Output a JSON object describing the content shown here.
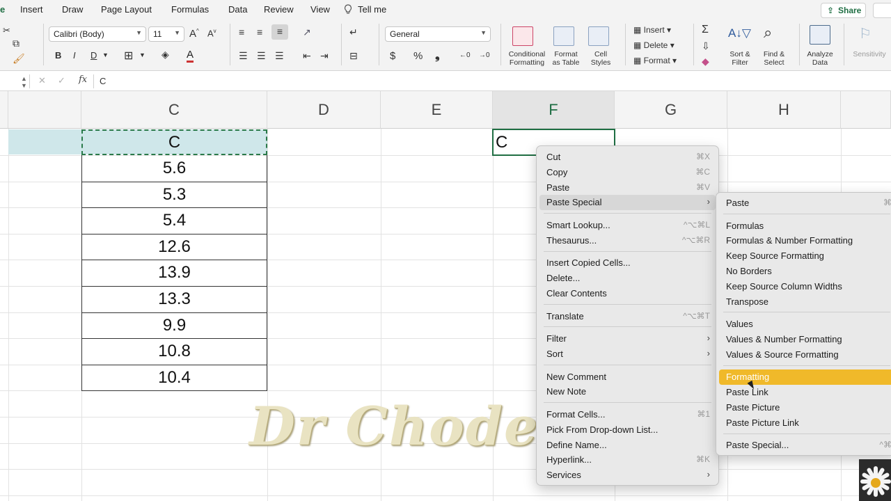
{
  "ribbon_tabs": [
    "Insert",
    "Draw",
    "Page Layout",
    "Formulas",
    "Data",
    "Review",
    "View"
  ],
  "tell_me": "Tell me",
  "share_label": "Share",
  "font": {
    "name": "Calibri (Body)",
    "size": "11"
  },
  "number_format": "General",
  "font_buttons": {
    "bold": "B",
    "italic": "I",
    "underline": "D"
  },
  "cells_group": {
    "insert": "Insert",
    "delete": "Delete",
    "format": "Format"
  },
  "big_buttons": [
    {
      "label": "Conditional\nFormatting"
    },
    {
      "label": "Format\nas Table"
    },
    {
      "label": "Cell\nStyles"
    },
    {
      "label": "Sort &\nFilter"
    },
    {
      "label": "Find &\nSelect"
    },
    {
      "label": "Analyze\nData"
    },
    {
      "label": "Sensitivity"
    }
  ],
  "formula_bar": {
    "fx": "fx",
    "value": "C"
  },
  "columns": [
    "C",
    "D",
    "E",
    "F",
    "G",
    "H"
  ],
  "column_c": {
    "header": "C",
    "values": [
      "5.6",
      "5.3",
      "5.4",
      "12.6",
      "13.9",
      "13.3",
      "9.9",
      "10.8",
      "10.4"
    ]
  },
  "f_cell": "C",
  "context_menu": [
    {
      "label": "Cut",
      "shortcut": "⌘X"
    },
    {
      "label": "Copy",
      "shortcut": "⌘C"
    },
    {
      "label": "Paste",
      "shortcut": "⌘V"
    },
    {
      "label": "Paste Special",
      "submenu": true,
      "state": "hover"
    },
    {
      "label": "Smart Lookup...",
      "shortcut": "^⌥⌘L"
    },
    {
      "label": "Thesaurus...",
      "shortcut": "^⌥⌘R"
    },
    {
      "label": "Insert Copied Cells..."
    },
    {
      "label": "Delete..."
    },
    {
      "label": "Clear Contents"
    },
    {
      "label": "Translate",
      "shortcut": "^⌥⌘T"
    },
    {
      "label": "Filter",
      "submenu": true
    },
    {
      "label": "Sort",
      "submenu": true
    },
    {
      "label": "New Comment"
    },
    {
      "label": "New Note"
    },
    {
      "label": "Format Cells...",
      "shortcut": "⌘1"
    },
    {
      "label": "Pick From Drop-down List..."
    },
    {
      "label": "Define Name..."
    },
    {
      "label": "Hyperlink...",
      "shortcut": "⌘K"
    },
    {
      "label": "Services",
      "submenu": true
    }
  ],
  "paste_submenu": [
    {
      "label": "Paste",
      "shortcut": "⌘V"
    },
    {
      "label": "Formulas"
    },
    {
      "label": "Formulas & Number Formatting"
    },
    {
      "label": "Keep Source Formatting"
    },
    {
      "label": "No Borders"
    },
    {
      "label": "Keep Source Column Widths"
    },
    {
      "label": "Transpose"
    },
    {
      "label": "Values"
    },
    {
      "label": "Values & Number Formatting"
    },
    {
      "label": "Values & Source Formatting"
    },
    {
      "label": "Formatting",
      "state": "selected"
    },
    {
      "label": "Paste Link"
    },
    {
      "label": "Paste Picture"
    },
    {
      "label": "Paste Picture Link"
    },
    {
      "label": "Paste Special...",
      "shortcut": "^⌘V"
    }
  ],
  "watermark": "Dr Choden",
  "colors": {
    "accent_green": "#1f6e43",
    "selection_highlight": "#f0b92a",
    "copied_cell_fill": "#cfe7ea"
  }
}
